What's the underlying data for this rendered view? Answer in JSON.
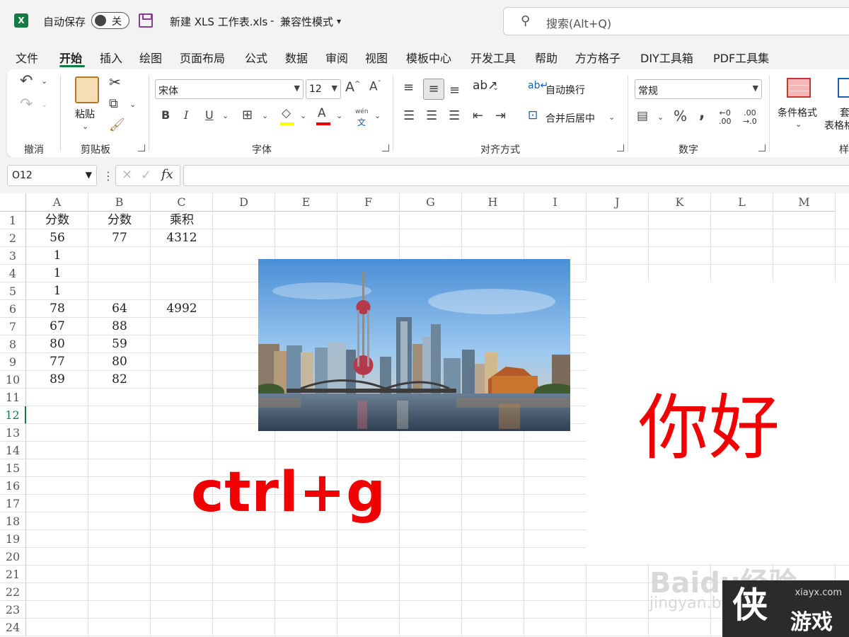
{
  "titlebar": {
    "app_icon": "X",
    "autosave_label": "自动保存",
    "autosave_state": "关",
    "filename": "新建 XLS 工作表.xls",
    "mode_sep": "-",
    "mode": "兼容性模式",
    "search_placeholder": "搜索(Alt+Q)"
  },
  "menu": [
    "文件",
    "开始",
    "插入",
    "绘图",
    "页面布局",
    "公式",
    "数据",
    "审阅",
    "视图",
    "模板中心",
    "开发工具",
    "帮助",
    "方方格子",
    "DIY工具箱",
    "PDF工具集"
  ],
  "ribbon": {
    "groups": {
      "undo": "撤消",
      "clipboard": "剪贴板",
      "font": "字体",
      "align": "对齐方式",
      "number": "数字",
      "styles_partial": "样"
    },
    "paste_label": "粘贴",
    "font_name": "宋体",
    "font_size": "12",
    "wrap_text": "自动换行",
    "merge_center": "合并后居中",
    "number_format": "常规",
    "cond_format": "条件格式",
    "table_format_1": "套",
    "table_format_2": "表格格",
    "wen_label": "wén",
    "wen_char": "文"
  },
  "formula_bar": {
    "name_box": "O12",
    "cancel_glyph": "✕",
    "confirm_glyph": "✓",
    "fx_glyph": "fx",
    "formula": ""
  },
  "sheet": {
    "columns": [
      "A",
      "B",
      "C",
      "D",
      "E",
      "F",
      "G",
      "H",
      "I",
      "J",
      "K",
      "L",
      "M"
    ],
    "rows": [
      "1",
      "2",
      "3",
      "4",
      "5",
      "6",
      "7",
      "8",
      "9",
      "10",
      "11",
      "12",
      "13",
      "14",
      "15",
      "16",
      "17",
      "18",
      "19",
      "20",
      "21",
      "22",
      "23",
      "24"
    ],
    "selected_row": "12",
    "cells": [
      [
        "分数",
        "分数",
        "乘积"
      ],
      [
        "56",
        "77",
        "4312"
      ],
      [
        "1",
        "",
        ""
      ],
      [
        "1",
        "",
        ""
      ],
      [
        "1",
        "",
        ""
      ],
      [
        "78",
        "64",
        "4992"
      ],
      [
        "67",
        "88",
        ""
      ],
      [
        "80",
        "59",
        ""
      ],
      [
        "77",
        "80",
        ""
      ],
      [
        "89",
        "82",
        ""
      ]
    ]
  },
  "overlay": {
    "shortcut": "ctrl+g",
    "greeting": "你好",
    "watermark_brand": "Baidu经验",
    "watermark_url": "jingyan.baidu.com",
    "badge_site": "xiayx.com",
    "badge_glyph": "侠",
    "badge_text": "游戏"
  },
  "colors": {
    "excel_green": "#107c41",
    "red_text": "#f00000"
  }
}
